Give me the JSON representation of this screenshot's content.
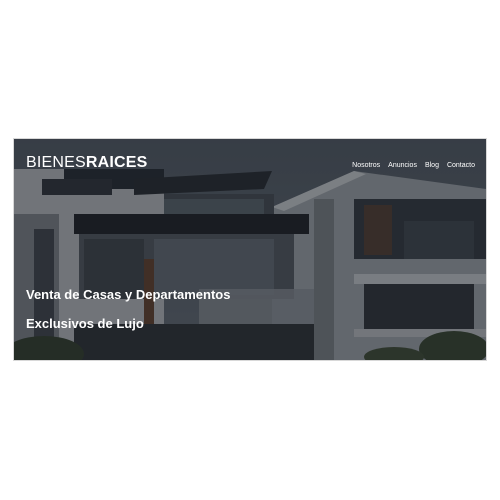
{
  "brand": {
    "part1": "BIENES",
    "part2": "RAICES"
  },
  "nav": {
    "items": [
      "Nosotros",
      "Anuncios",
      "Blog",
      "Contacto"
    ]
  },
  "hero": {
    "line1": "Venta de Casas y Departamentos",
    "line2": "Exclusivos de Lujo"
  },
  "colors": {
    "text": "#ffffff",
    "overlay": "#14181e",
    "page_bg": "#ffffff"
  }
}
